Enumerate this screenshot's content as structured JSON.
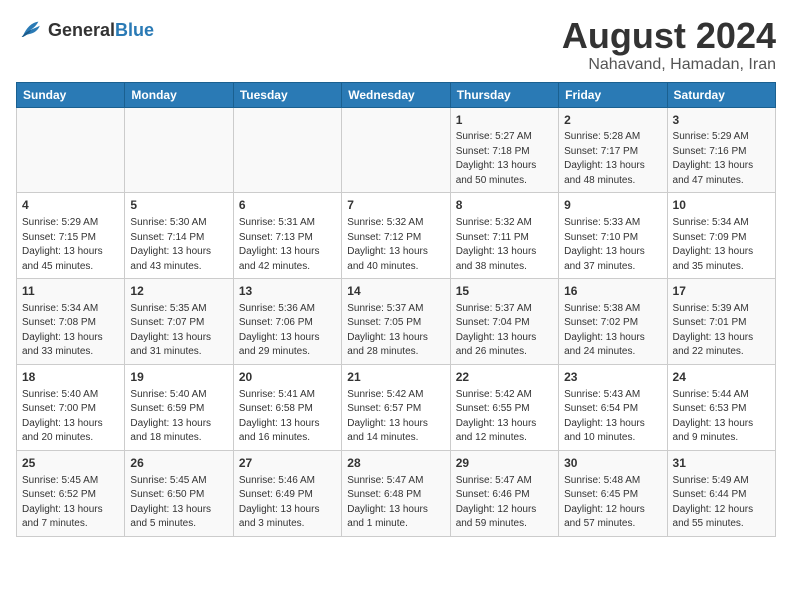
{
  "header": {
    "logo_general": "General",
    "logo_blue": "Blue",
    "main_title": "August 2024",
    "subtitle": "Nahavand, Hamadan, Iran"
  },
  "calendar": {
    "days_of_week": [
      "Sunday",
      "Monday",
      "Tuesday",
      "Wednesday",
      "Thursday",
      "Friday",
      "Saturday"
    ],
    "weeks": [
      [
        {
          "day": "",
          "info": ""
        },
        {
          "day": "",
          "info": ""
        },
        {
          "day": "",
          "info": ""
        },
        {
          "day": "",
          "info": ""
        },
        {
          "day": "1",
          "info": "Sunrise: 5:27 AM\nSunset: 7:18 PM\nDaylight: 13 hours and 50 minutes."
        },
        {
          "day": "2",
          "info": "Sunrise: 5:28 AM\nSunset: 7:17 PM\nDaylight: 13 hours and 48 minutes."
        },
        {
          "day": "3",
          "info": "Sunrise: 5:29 AM\nSunset: 7:16 PM\nDaylight: 13 hours and 47 minutes."
        }
      ],
      [
        {
          "day": "4",
          "info": "Sunrise: 5:29 AM\nSunset: 7:15 PM\nDaylight: 13 hours and 45 minutes."
        },
        {
          "day": "5",
          "info": "Sunrise: 5:30 AM\nSunset: 7:14 PM\nDaylight: 13 hours and 43 minutes."
        },
        {
          "day": "6",
          "info": "Sunrise: 5:31 AM\nSunset: 7:13 PM\nDaylight: 13 hours and 42 minutes."
        },
        {
          "day": "7",
          "info": "Sunrise: 5:32 AM\nSunset: 7:12 PM\nDaylight: 13 hours and 40 minutes."
        },
        {
          "day": "8",
          "info": "Sunrise: 5:32 AM\nSunset: 7:11 PM\nDaylight: 13 hours and 38 minutes."
        },
        {
          "day": "9",
          "info": "Sunrise: 5:33 AM\nSunset: 7:10 PM\nDaylight: 13 hours and 37 minutes."
        },
        {
          "day": "10",
          "info": "Sunrise: 5:34 AM\nSunset: 7:09 PM\nDaylight: 13 hours and 35 minutes."
        }
      ],
      [
        {
          "day": "11",
          "info": "Sunrise: 5:34 AM\nSunset: 7:08 PM\nDaylight: 13 hours and 33 minutes."
        },
        {
          "day": "12",
          "info": "Sunrise: 5:35 AM\nSunset: 7:07 PM\nDaylight: 13 hours and 31 minutes."
        },
        {
          "day": "13",
          "info": "Sunrise: 5:36 AM\nSunset: 7:06 PM\nDaylight: 13 hours and 29 minutes."
        },
        {
          "day": "14",
          "info": "Sunrise: 5:37 AM\nSunset: 7:05 PM\nDaylight: 13 hours and 28 minutes."
        },
        {
          "day": "15",
          "info": "Sunrise: 5:37 AM\nSunset: 7:04 PM\nDaylight: 13 hours and 26 minutes."
        },
        {
          "day": "16",
          "info": "Sunrise: 5:38 AM\nSunset: 7:02 PM\nDaylight: 13 hours and 24 minutes."
        },
        {
          "day": "17",
          "info": "Sunrise: 5:39 AM\nSunset: 7:01 PM\nDaylight: 13 hours and 22 minutes."
        }
      ],
      [
        {
          "day": "18",
          "info": "Sunrise: 5:40 AM\nSunset: 7:00 PM\nDaylight: 13 hours and 20 minutes."
        },
        {
          "day": "19",
          "info": "Sunrise: 5:40 AM\nSunset: 6:59 PM\nDaylight: 13 hours and 18 minutes."
        },
        {
          "day": "20",
          "info": "Sunrise: 5:41 AM\nSunset: 6:58 PM\nDaylight: 13 hours and 16 minutes."
        },
        {
          "day": "21",
          "info": "Sunrise: 5:42 AM\nSunset: 6:57 PM\nDaylight: 13 hours and 14 minutes."
        },
        {
          "day": "22",
          "info": "Sunrise: 5:42 AM\nSunset: 6:55 PM\nDaylight: 13 hours and 12 minutes."
        },
        {
          "day": "23",
          "info": "Sunrise: 5:43 AM\nSunset: 6:54 PM\nDaylight: 13 hours and 10 minutes."
        },
        {
          "day": "24",
          "info": "Sunrise: 5:44 AM\nSunset: 6:53 PM\nDaylight: 13 hours and 9 minutes."
        }
      ],
      [
        {
          "day": "25",
          "info": "Sunrise: 5:45 AM\nSunset: 6:52 PM\nDaylight: 13 hours and 7 minutes."
        },
        {
          "day": "26",
          "info": "Sunrise: 5:45 AM\nSunset: 6:50 PM\nDaylight: 13 hours and 5 minutes."
        },
        {
          "day": "27",
          "info": "Sunrise: 5:46 AM\nSunset: 6:49 PM\nDaylight: 13 hours and 3 minutes."
        },
        {
          "day": "28",
          "info": "Sunrise: 5:47 AM\nSunset: 6:48 PM\nDaylight: 13 hours and 1 minute."
        },
        {
          "day": "29",
          "info": "Sunrise: 5:47 AM\nSunset: 6:46 PM\nDaylight: 12 hours and 59 minutes."
        },
        {
          "day": "30",
          "info": "Sunrise: 5:48 AM\nSunset: 6:45 PM\nDaylight: 12 hours and 57 minutes."
        },
        {
          "day": "31",
          "info": "Sunrise: 5:49 AM\nSunset: 6:44 PM\nDaylight: 12 hours and 55 minutes."
        }
      ]
    ]
  }
}
